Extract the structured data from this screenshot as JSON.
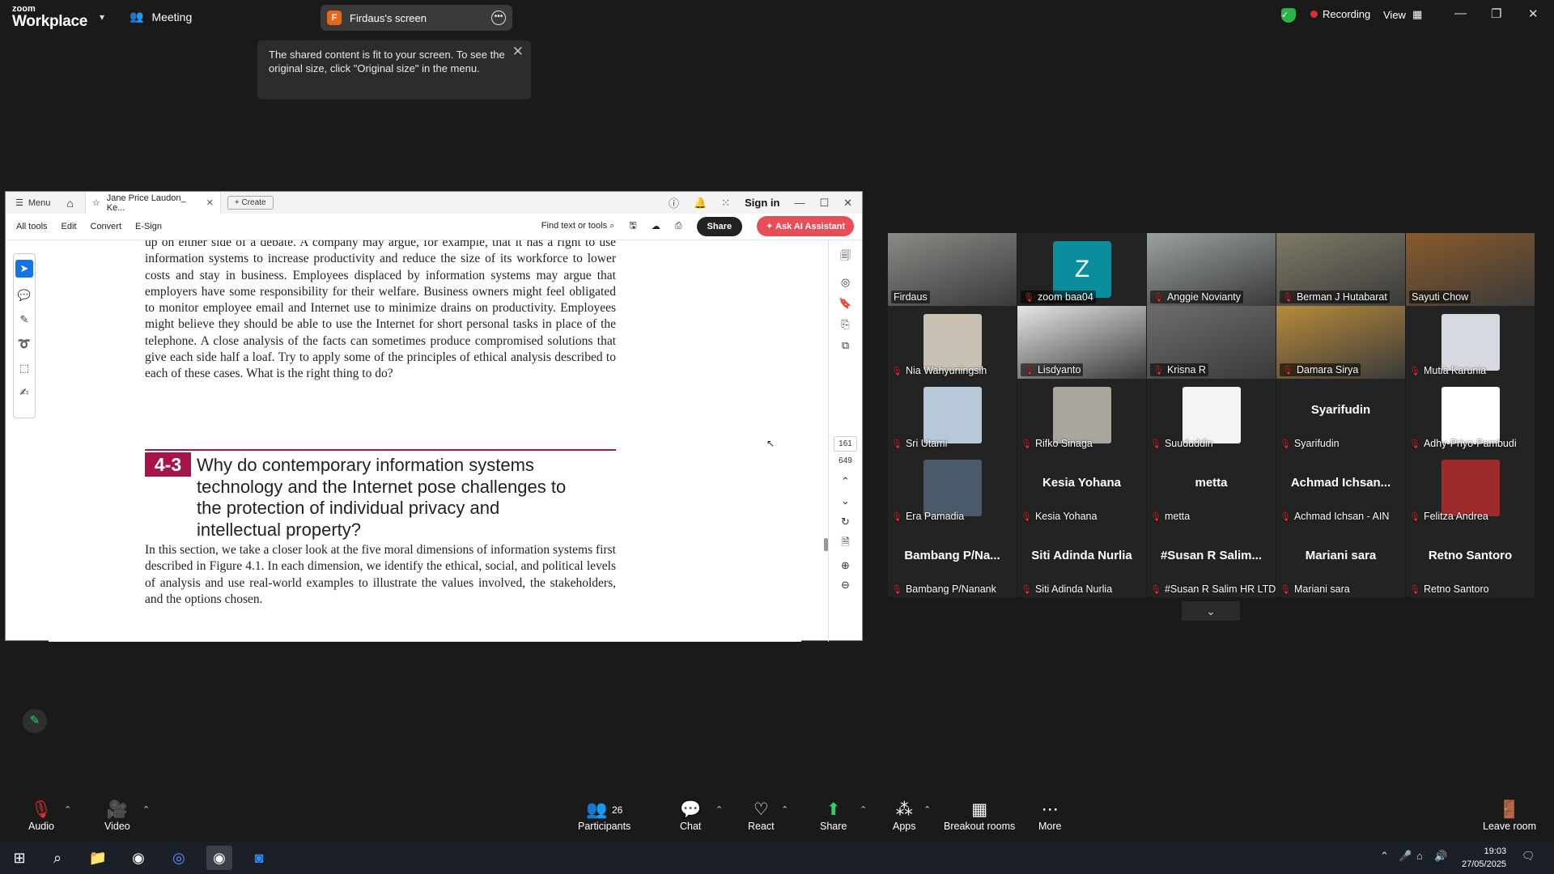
{
  "app": {
    "logo_small": "zoom",
    "logo_big": "Workplace",
    "meeting_label": "Meeting",
    "share_initial": "F",
    "share_title": "Firdaus's screen",
    "recording_label": "Recording",
    "view_label": "View"
  },
  "toast": {
    "message": "The shared content is fit to your screen. To see the original size, click \"Original size\" in the menu."
  },
  "acrobat": {
    "menu_label": "Menu",
    "doc_tab": "Jane Price Laudon_ Ke...",
    "create_label": "Create",
    "signin_label": "Sign in",
    "toolbar": {
      "all_tools": "All tools",
      "edit": "Edit",
      "convert": "Convert",
      "esign": "E-Sign",
      "find": "Find text or tools",
      "share": "Share",
      "ai": "Ask AI Assistant"
    },
    "page_number": "161",
    "page_total": "649",
    "para1": "up on either side of a debate. A company may argue, for example, that it has a right to use information systems to increase productivity and reduce the size of its workforce to lower costs and stay in business. Employees displaced by information systems may argue that employers have some responsibility for their welfare. Business owners might feel obligated to monitor employee email and Internet use to minimize drains on productivity. Employees might believe they should be able to use the Internet for short personal tasks in place of the telephone. A close analysis of the facts can sometimes produce compromised solutions that give each side half a loaf. Try to apply some of the principles of ethical analysis described to each of these cases. What is the right thing to do?",
    "section_num": "4-3",
    "section_title": "Why do contemporary information systems technology and the Internet pose challenges to the protection of individual privacy and intellectual property?",
    "para2": "In this section, we take a closer look at the five moral dimensions of information systems first described in Figure 4.1. In each dimension, we identify the ethical, social, and political levels of analysis and use real-world examples to illustrate the values involved, the stakeholders, and the options chosen."
  },
  "participants": [
    {
      "name": "Firdaus",
      "muted": false,
      "kind": "video",
      "bg": "#8a8a86"
    },
    {
      "name": "zoom baa04",
      "muted": true,
      "kind": "letter",
      "letter": "Z"
    },
    {
      "name": "Anggie Novianty",
      "muted": true,
      "kind": "video",
      "bg": "#9aa2a0"
    },
    {
      "name": "Berman J Hutabarat",
      "muted": true,
      "kind": "video",
      "bg": "#7f7a66"
    },
    {
      "name": "Sayuti Chow",
      "muted": false,
      "kind": "video",
      "bg": "#8a5a2a",
      "active": true
    },
    {
      "name": "Nia Wahyuningsih",
      "muted": true,
      "kind": "avatar",
      "bg": "#c9c1b3"
    },
    {
      "name": "Lisdyanto",
      "muted": true,
      "kind": "video",
      "bg": "#e6e6e6"
    },
    {
      "name": "Krisna R",
      "muted": true,
      "kind": "video",
      "bg": "#6d6d6d"
    },
    {
      "name": "Damara Sirya",
      "muted": true,
      "kind": "video",
      "bg": "#b88a3a"
    },
    {
      "name": "Mutia Karunia",
      "muted": true,
      "kind": "avatar",
      "bg": "#d6d9e0"
    },
    {
      "name": "Sri Utami",
      "muted": true,
      "kind": "avatar",
      "bg": "#b7c8d8"
    },
    {
      "name": "Rifko Sinaga",
      "muted": true,
      "kind": "avatar",
      "bg": "#a9a69e"
    },
    {
      "name": "Suududdin",
      "muted": true,
      "kind": "avatar",
      "bg": "#f4f4f4"
    },
    {
      "name": "Syarifudin",
      "muted": true,
      "kind": "text",
      "big": "Syarifudin"
    },
    {
      "name": "Adhy-Priyo-Pambudi",
      "muted": true,
      "kind": "avatar",
      "bg": "#ffffff"
    },
    {
      "name": "Era Pamadia",
      "muted": true,
      "kind": "avatar",
      "bg": "#4b5a6a"
    },
    {
      "name": "Kesia Yohana",
      "muted": true,
      "kind": "text",
      "big": "Kesia Yohana"
    },
    {
      "name": "metta",
      "muted": true,
      "kind": "text",
      "big": "metta"
    },
    {
      "name": "Achmad Ichsan - AIN",
      "muted": true,
      "kind": "text",
      "big": "Achmad  Ichsan..."
    },
    {
      "name": "Felitza Andrea",
      "muted": true,
      "kind": "avatar",
      "bg": "#9e2a2a"
    },
    {
      "name": "Bambang P/Nanank",
      "muted": true,
      "kind": "text",
      "big": "Bambang P/Na..."
    },
    {
      "name": "Siti Adinda Nurlia",
      "muted": true,
      "kind": "text",
      "big": "Siti Adinda Nurlia"
    },
    {
      "name": "#Susan R Salim HR LTD",
      "muted": true,
      "kind": "text",
      "big": "#Susan  R  Salim..."
    },
    {
      "name": "Mariani sara",
      "muted": true,
      "kind": "text",
      "big": "Mariani sara"
    },
    {
      "name": "Retno Santoro",
      "muted": true,
      "kind": "text",
      "big": "Retno Santoro"
    }
  ],
  "bottombar": {
    "audio": "Audio",
    "video": "Video",
    "participants_count": "26",
    "participants": "Participants",
    "chat": "Chat",
    "react": "React",
    "share": "Share",
    "apps": "Apps",
    "breakout": "Breakout rooms",
    "more": "More",
    "leave": "Leave room"
  },
  "taskbar": {
    "time": "19:03",
    "date": "27/05/2025"
  }
}
